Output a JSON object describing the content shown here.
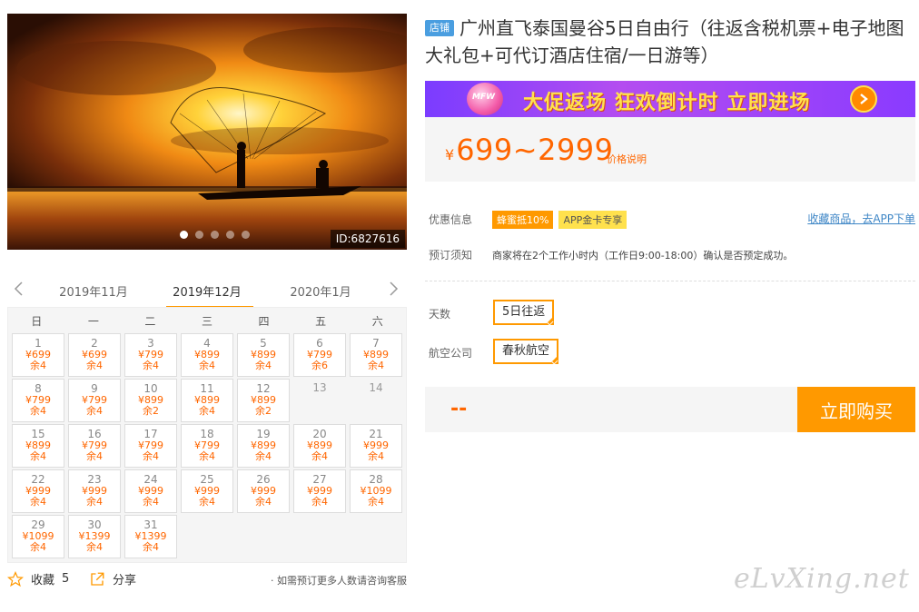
{
  "photo": {
    "id_label": "ID:6827616",
    "dot_count": 5,
    "active_dot": 0
  },
  "calendar": {
    "prev_month": "2019年11月",
    "current_month": "2019年12月",
    "next_month": "2020年1月",
    "weekdays": [
      "日",
      "一",
      "二",
      "三",
      "四",
      "五",
      "六"
    ],
    "days": [
      {
        "d": "1",
        "p": "¥699",
        "r": "余4"
      },
      {
        "d": "2",
        "p": "¥699",
        "r": "余4"
      },
      {
        "d": "3",
        "p": "¥799",
        "r": "余4"
      },
      {
        "d": "4",
        "p": "¥899",
        "r": "余4"
      },
      {
        "d": "5",
        "p": "¥899",
        "r": "余4"
      },
      {
        "d": "6",
        "p": "¥799",
        "r": "余6"
      },
      {
        "d": "7",
        "p": "¥899",
        "r": "余4"
      },
      {
        "d": "8",
        "p": "¥799",
        "r": "余4"
      },
      {
        "d": "9",
        "p": "¥799",
        "r": "余4"
      },
      {
        "d": "10",
        "p": "¥899",
        "r": "余2"
      },
      {
        "d": "11",
        "p": "¥899",
        "r": "余4"
      },
      {
        "d": "12",
        "p": "¥899",
        "r": "余2"
      },
      {
        "d": "13",
        "p": "",
        "r": ""
      },
      {
        "d": "14",
        "p": "",
        "r": ""
      },
      {
        "d": "15",
        "p": "¥899",
        "r": "余4"
      },
      {
        "d": "16",
        "p": "¥799",
        "r": "余4"
      },
      {
        "d": "17",
        "p": "¥799",
        "r": "余4"
      },
      {
        "d": "18",
        "p": "¥799",
        "r": "余4"
      },
      {
        "d": "19",
        "p": "¥899",
        "r": "余4"
      },
      {
        "d": "20",
        "p": "¥899",
        "r": "余4"
      },
      {
        "d": "21",
        "p": "¥999",
        "r": "余4"
      },
      {
        "d": "22",
        "p": "¥999",
        "r": "余4"
      },
      {
        "d": "23",
        "p": "¥999",
        "r": "余4"
      },
      {
        "d": "24",
        "p": "¥999",
        "r": "余4"
      },
      {
        "d": "25",
        "p": "¥999",
        "r": "余4"
      },
      {
        "d": "26",
        "p": "¥999",
        "r": "余4"
      },
      {
        "d": "27",
        "p": "¥999",
        "r": "余4"
      },
      {
        "d": "28",
        "p": "¥1099",
        "r": "余4"
      },
      {
        "d": "29",
        "p": "¥1099",
        "r": "余4"
      },
      {
        "d": "30",
        "p": "¥1399",
        "r": "余4"
      },
      {
        "d": "31",
        "p": "¥1399",
        "r": "余4"
      }
    ]
  },
  "bottom": {
    "fav_label": "收藏",
    "fav_count": "5",
    "share_label": "分享",
    "consult_text": "· 如需预订更多人数请咨询客服"
  },
  "product": {
    "shop_badge": "店铺",
    "title": "广州直飞泰国曼谷5日自由行（往返含税机票+电子地图大礼包+可代订酒店住宿/一日游等）",
    "banner_text": "大促返场 狂欢倒计时 立即进场",
    "banner_logo": "MFW",
    "price_currency": "¥",
    "price_range": "699~2999",
    "price_note": "价格说明"
  },
  "info": {
    "discount_label": "优惠信息",
    "tags": [
      "蜂蜜抵10%",
      "APP金卡专享"
    ],
    "app_link": "收藏商品，去APP下单",
    "notice_label": "预订须知",
    "notice_text": "商家将在2个工作小时内（工作日9:00-18:00）确认是否预定成功。"
  },
  "options": {
    "days_label": "天数",
    "days_value": "5日往返",
    "airline_label": "航空公司",
    "airline_value": "春秋航空"
  },
  "purchase": {
    "total": "--",
    "buy_label": "立即购买"
  },
  "watermark": "eLvXing.net",
  "colors": {
    "accent": "#ff9900",
    "price": "#ff6600",
    "link": "#3e86c6"
  }
}
